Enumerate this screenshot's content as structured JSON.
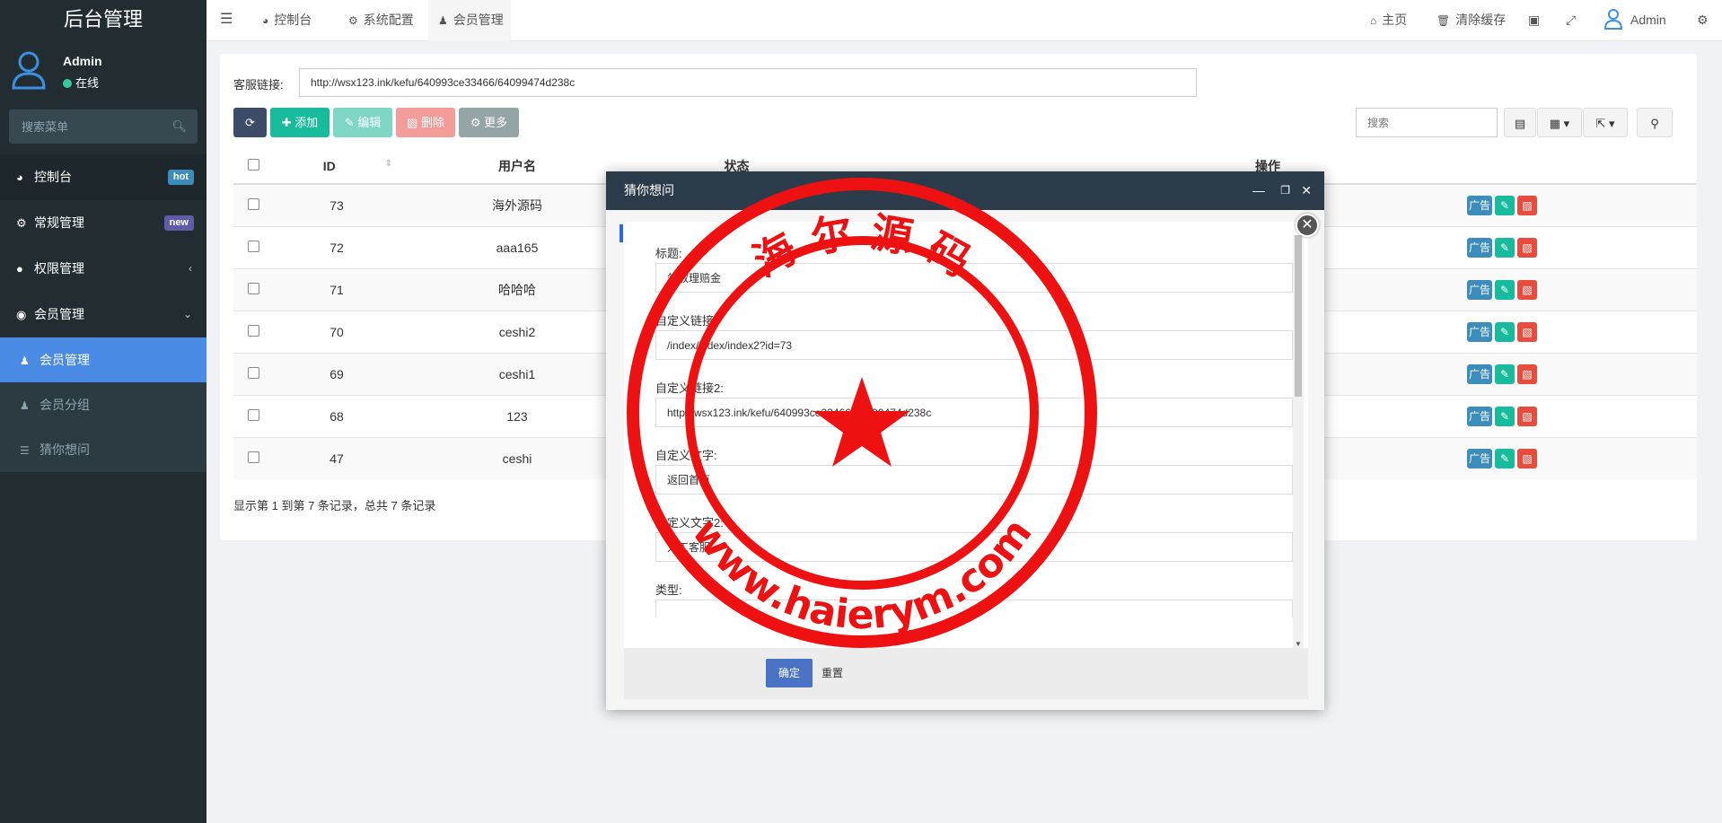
{
  "app": {
    "title": "后台管理"
  },
  "user": {
    "name": "Admin",
    "status": "在线"
  },
  "sidebar": {
    "search_placeholder": "搜索菜单",
    "items": [
      {
        "label": "控制台",
        "badge": "hot",
        "badge_color": "#3c8dbc"
      },
      {
        "label": "常规管理",
        "badge": "new",
        "badge_color": "#605ca8"
      },
      {
        "label": "权限管理"
      },
      {
        "label": "会员管理"
      }
    ],
    "sub_items": [
      {
        "label": "会员管理"
      },
      {
        "label": "会员分组"
      },
      {
        "label": "猜你想问"
      }
    ]
  },
  "topbar": {
    "tabs": [
      {
        "label": "控制台",
        "icon": "dashboard-icon"
      },
      {
        "label": "系统配置",
        "icon": "gear-icon"
      },
      {
        "label": "会员管理",
        "icon": "user-icon"
      }
    ],
    "home": "主页",
    "clear_cache": "清除缓存",
    "admin": "Admin"
  },
  "main": {
    "url_label": "客服链接:",
    "url_value": "http://wsx123.ink/kefu/640993ce33466/64099474d238c",
    "toolbar": {
      "add": "添加",
      "edit": "编辑",
      "delete": "删除",
      "more": "更多"
    },
    "search_placeholder": "搜索",
    "table": {
      "headers": [
        "ID",
        "用户名",
        "状态",
        "操作"
      ],
      "rows": [
        {
          "id": "73",
          "username": "海外源码"
        },
        {
          "id": "72",
          "username": "aaa165"
        },
        {
          "id": "71",
          "username": "哈哈哈"
        },
        {
          "id": "70",
          "username": "ceshi2"
        },
        {
          "id": "69",
          "username": "ceshi1"
        },
        {
          "id": "68",
          "username": "123"
        },
        {
          "id": "47",
          "username": "ceshi"
        }
      ],
      "ad_label": "广告"
    },
    "pager": "显示第 1 到第 7 条记录，总共 7 条记录"
  },
  "modal": {
    "title": "猜你想问",
    "fields": [
      {
        "label": "标题:",
        "value": "领取理赔金"
      },
      {
        "label": "自定义链接:",
        "value": "/index/index/index2?id=73"
      },
      {
        "label": "自定义链接2:",
        "value": "http://wsx123.ink/kefu/640993ce33466/64099474d238c"
      },
      {
        "label": "自定义文字:",
        "value": "返回首页"
      },
      {
        "label": "自定义文字2:",
        "value": "人工客服"
      },
      {
        "label": "类型:",
        "value": ""
      }
    ],
    "ok": "确定",
    "reset": "重置"
  },
  "watermark": {
    "top_text": "海 尔 源 码",
    "bottom_text": "www.haierym.com",
    "color": "#ee1111"
  },
  "colors": {
    "sidebar": "#222d32",
    "accent": "#4a8be5",
    "success": "#18bc9c",
    "danger": "#e74c3c",
    "modal_header": "#2c3b4a"
  }
}
